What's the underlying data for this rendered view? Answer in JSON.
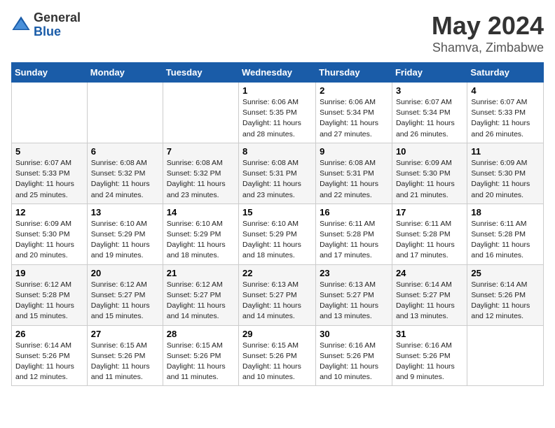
{
  "logo": {
    "general": "General",
    "blue": "Blue"
  },
  "title": "May 2024",
  "subtitle": "Shamva, Zimbabwe",
  "days_of_week": [
    "Sunday",
    "Monday",
    "Tuesday",
    "Wednesday",
    "Thursday",
    "Friday",
    "Saturday"
  ],
  "weeks": [
    [
      {
        "day": "",
        "info": ""
      },
      {
        "day": "",
        "info": ""
      },
      {
        "day": "",
        "info": ""
      },
      {
        "day": "1",
        "info": "Sunrise: 6:06 AM\nSunset: 5:35 PM\nDaylight: 11 hours and 28 minutes."
      },
      {
        "day": "2",
        "info": "Sunrise: 6:06 AM\nSunset: 5:34 PM\nDaylight: 11 hours and 27 minutes."
      },
      {
        "day": "3",
        "info": "Sunrise: 6:07 AM\nSunset: 5:34 PM\nDaylight: 11 hours and 26 minutes."
      },
      {
        "day": "4",
        "info": "Sunrise: 6:07 AM\nSunset: 5:33 PM\nDaylight: 11 hours and 26 minutes."
      }
    ],
    [
      {
        "day": "5",
        "info": "Sunrise: 6:07 AM\nSunset: 5:33 PM\nDaylight: 11 hours and 25 minutes."
      },
      {
        "day": "6",
        "info": "Sunrise: 6:08 AM\nSunset: 5:32 PM\nDaylight: 11 hours and 24 minutes."
      },
      {
        "day": "7",
        "info": "Sunrise: 6:08 AM\nSunset: 5:32 PM\nDaylight: 11 hours and 23 minutes."
      },
      {
        "day": "8",
        "info": "Sunrise: 6:08 AM\nSunset: 5:31 PM\nDaylight: 11 hours and 23 minutes."
      },
      {
        "day": "9",
        "info": "Sunrise: 6:08 AM\nSunset: 5:31 PM\nDaylight: 11 hours and 22 minutes."
      },
      {
        "day": "10",
        "info": "Sunrise: 6:09 AM\nSunset: 5:30 PM\nDaylight: 11 hours and 21 minutes."
      },
      {
        "day": "11",
        "info": "Sunrise: 6:09 AM\nSunset: 5:30 PM\nDaylight: 11 hours and 20 minutes."
      }
    ],
    [
      {
        "day": "12",
        "info": "Sunrise: 6:09 AM\nSunset: 5:30 PM\nDaylight: 11 hours and 20 minutes."
      },
      {
        "day": "13",
        "info": "Sunrise: 6:10 AM\nSunset: 5:29 PM\nDaylight: 11 hours and 19 minutes."
      },
      {
        "day": "14",
        "info": "Sunrise: 6:10 AM\nSunset: 5:29 PM\nDaylight: 11 hours and 18 minutes."
      },
      {
        "day": "15",
        "info": "Sunrise: 6:10 AM\nSunset: 5:29 PM\nDaylight: 11 hours and 18 minutes."
      },
      {
        "day": "16",
        "info": "Sunrise: 6:11 AM\nSunset: 5:28 PM\nDaylight: 11 hours and 17 minutes."
      },
      {
        "day": "17",
        "info": "Sunrise: 6:11 AM\nSunset: 5:28 PM\nDaylight: 11 hours and 17 minutes."
      },
      {
        "day": "18",
        "info": "Sunrise: 6:11 AM\nSunset: 5:28 PM\nDaylight: 11 hours and 16 minutes."
      }
    ],
    [
      {
        "day": "19",
        "info": "Sunrise: 6:12 AM\nSunset: 5:28 PM\nDaylight: 11 hours and 15 minutes."
      },
      {
        "day": "20",
        "info": "Sunrise: 6:12 AM\nSunset: 5:27 PM\nDaylight: 11 hours and 15 minutes."
      },
      {
        "day": "21",
        "info": "Sunrise: 6:12 AM\nSunset: 5:27 PM\nDaylight: 11 hours and 14 minutes."
      },
      {
        "day": "22",
        "info": "Sunrise: 6:13 AM\nSunset: 5:27 PM\nDaylight: 11 hours and 14 minutes."
      },
      {
        "day": "23",
        "info": "Sunrise: 6:13 AM\nSunset: 5:27 PM\nDaylight: 11 hours and 13 minutes."
      },
      {
        "day": "24",
        "info": "Sunrise: 6:14 AM\nSunset: 5:27 PM\nDaylight: 11 hours and 13 minutes."
      },
      {
        "day": "25",
        "info": "Sunrise: 6:14 AM\nSunset: 5:26 PM\nDaylight: 11 hours and 12 minutes."
      }
    ],
    [
      {
        "day": "26",
        "info": "Sunrise: 6:14 AM\nSunset: 5:26 PM\nDaylight: 11 hours and 12 minutes."
      },
      {
        "day": "27",
        "info": "Sunrise: 6:15 AM\nSunset: 5:26 PM\nDaylight: 11 hours and 11 minutes."
      },
      {
        "day": "28",
        "info": "Sunrise: 6:15 AM\nSunset: 5:26 PM\nDaylight: 11 hours and 11 minutes."
      },
      {
        "day": "29",
        "info": "Sunrise: 6:15 AM\nSunset: 5:26 PM\nDaylight: 11 hours and 10 minutes."
      },
      {
        "day": "30",
        "info": "Sunrise: 6:16 AM\nSunset: 5:26 PM\nDaylight: 11 hours and 10 minutes."
      },
      {
        "day": "31",
        "info": "Sunrise: 6:16 AM\nSunset: 5:26 PM\nDaylight: 11 hours and 9 minutes."
      },
      {
        "day": "",
        "info": ""
      }
    ]
  ]
}
